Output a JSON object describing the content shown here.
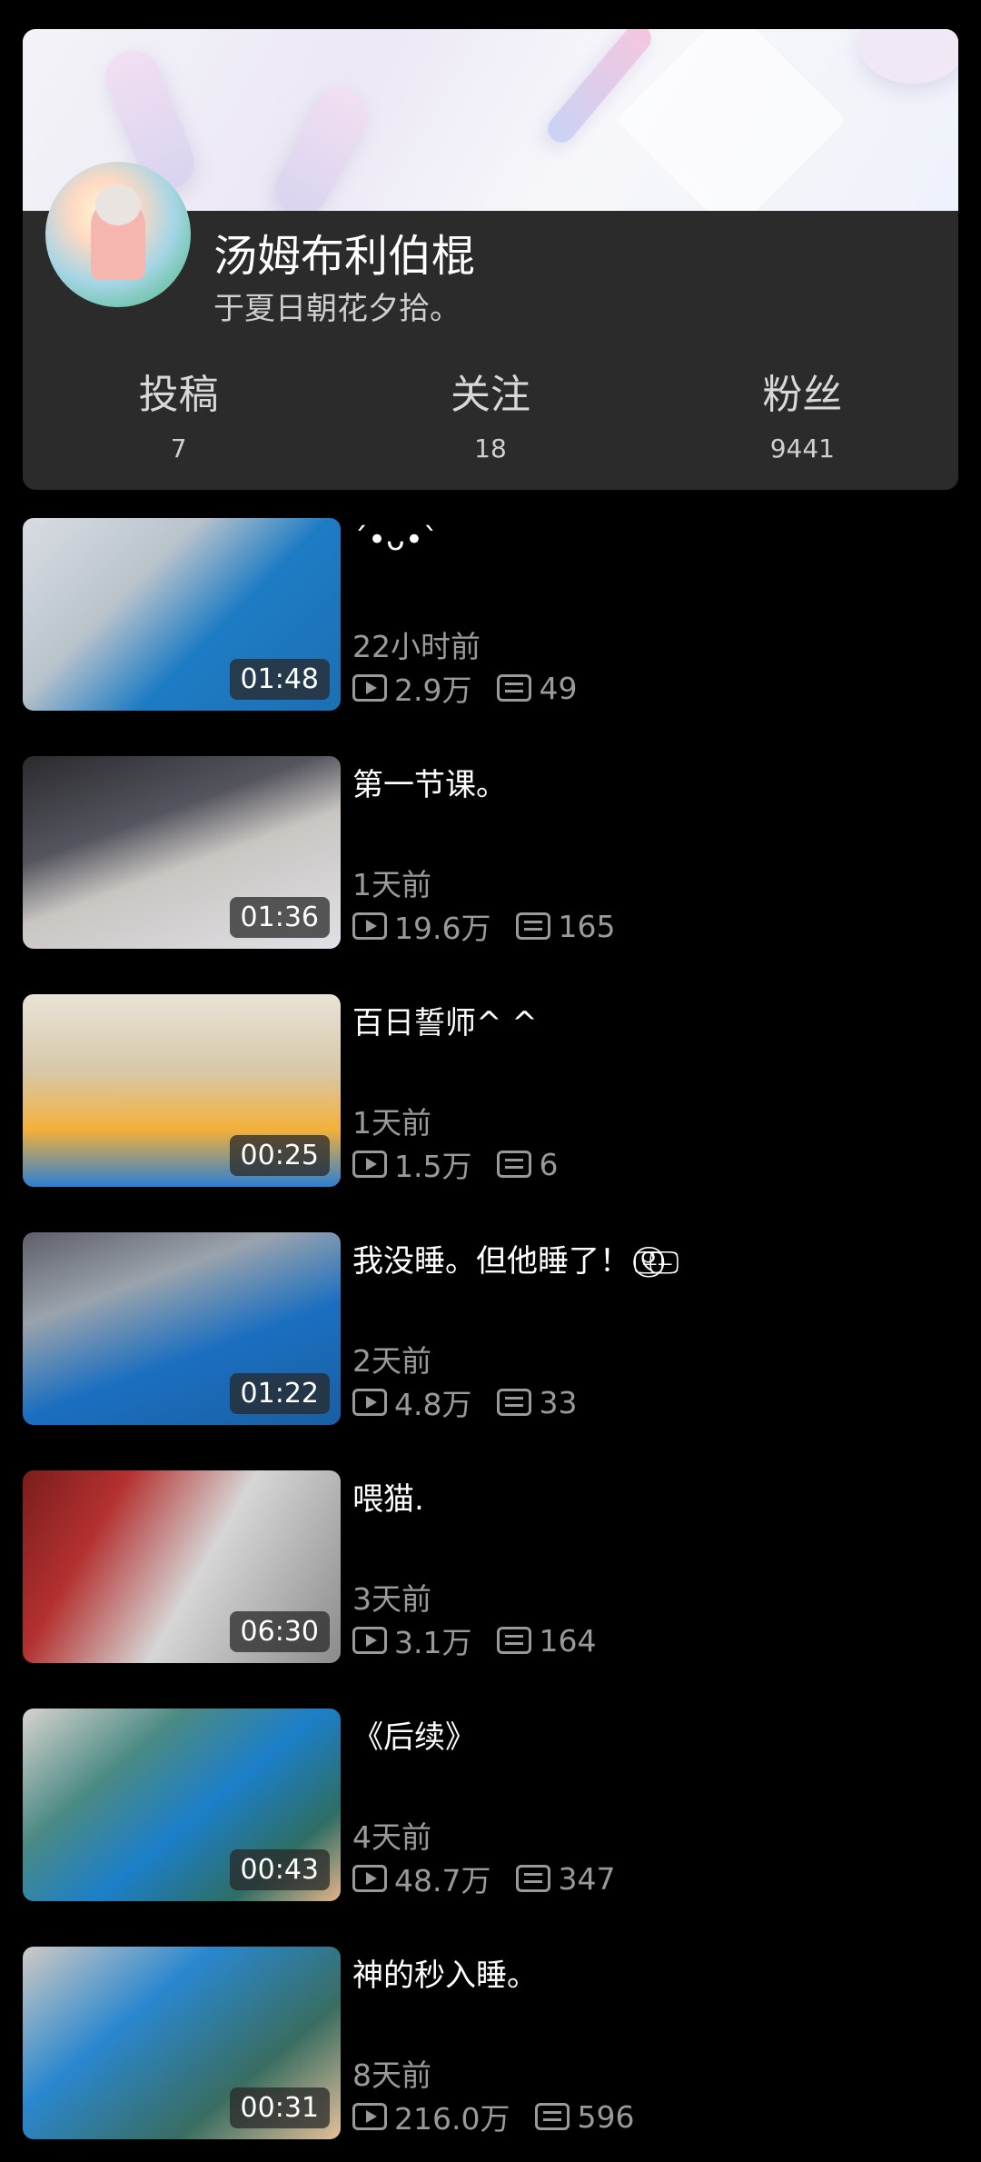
{
  "profile": {
    "name": "汤姆布利伯棍",
    "bio": "于夏日朝花夕拾。",
    "stats": [
      {
        "label": "投稿",
        "value": "7"
      },
      {
        "label": "关注",
        "value": "18"
      },
      {
        "label": "粉丝",
        "value": "9441"
      }
    ]
  },
  "videos": [
    {
      "title": "´•ᴗ•`",
      "time": "22小时前",
      "views": "2.9万",
      "danmaku": "49",
      "duration": "01:48"
    },
    {
      "title": "第一节课。",
      "time": "1天前",
      "views": "19.6万",
      "danmaku": "165",
      "duration": "01:36"
    },
    {
      "title": "百日誓师^ ^",
      "time": "1天前",
      "views": "1.5万",
      "danmaku": "6",
      "duration": "00:25"
    },
    {
      "title": "我没睡。但他睡了！ ୧⃢⃝̶ ̶̶̶̶⃢",
      "time": "2天前",
      "views": "4.8万",
      "danmaku": "33",
      "duration": "01:22"
    },
    {
      "title": "喂猫.",
      "time": "3天前",
      "views": "3.1万",
      "danmaku": "164",
      "duration": "06:30"
    },
    {
      "title": "《后续》",
      "time": "4天前",
      "views": "48.7万",
      "danmaku": "347",
      "duration": "00:43"
    },
    {
      "title": "神的秒入睡。",
      "time": "8天前",
      "views": "216.0万",
      "danmaku": "596",
      "duration": "00:31"
    }
  ]
}
